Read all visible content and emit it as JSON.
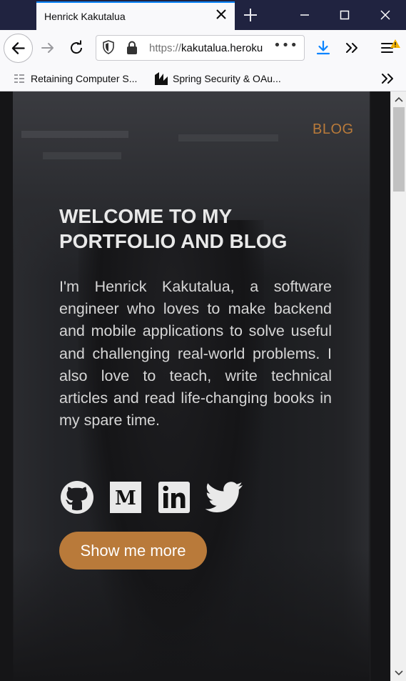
{
  "browser": {
    "tab_title": "Henrick Kakutalua",
    "url_scheme": "https://",
    "url_host": "kakutalua.heroku",
    "url_more": "•••",
    "bookmarks": [
      {
        "label": "Retaining Computer S..."
      },
      {
        "label": "Spring Security & OAu..."
      }
    ],
    "colors": {
      "titlebar": "#202340",
      "tab_accent": "#0a84ff",
      "download": "#0a84ff",
      "warning": "#f5b400"
    }
  },
  "page": {
    "nav": {
      "blog_label": "BLOG"
    },
    "hero": {
      "title": "WELCOME TO MY PORTFOLIO AND BLOG",
      "intro": "I'm Henrick Kakutalua, a software engineer who loves to make backend and mobile applications to solve useful and challenging real-world problems. I also love to teach, write technical articles and read life-changing books in my spare time.",
      "cta_label": "Show me more"
    },
    "social": [
      {
        "icon": "github-icon"
      },
      {
        "icon": "medium-icon"
      },
      {
        "icon": "linkedin-icon"
      },
      {
        "icon": "twitter-icon"
      }
    ],
    "colors": {
      "accent": "#b97a3a",
      "text": "#e9e9e9"
    }
  }
}
